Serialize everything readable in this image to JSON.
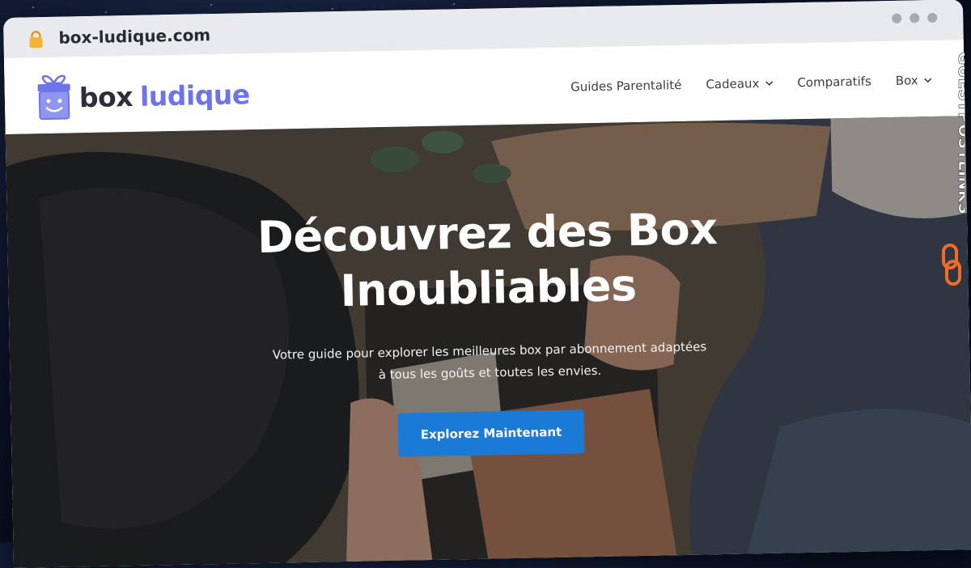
{
  "browser": {
    "url": "box-ludique.com"
  },
  "logo": {
    "word1": "box",
    "word2": "ludique"
  },
  "nav": {
    "items": [
      {
        "label": "Guides Parentalité",
        "has_dropdown": false
      },
      {
        "label": "Cadeaux",
        "has_dropdown": true
      },
      {
        "label": "Comparatifs",
        "has_dropdown": false
      },
      {
        "label": "Box",
        "has_dropdown": true
      }
    ]
  },
  "hero": {
    "title": "Découvrez des Box Inoubliables",
    "subtitle": "Votre guide pour explorer les meilleures box par abonnement adaptées à tous les goûts et toutes les envies.",
    "cta_label": "Explorez Maintenant"
  },
  "watermark": {
    "text": "GUESTPOSTLINKS"
  },
  "colors": {
    "brand_accent": "#6d73e8",
    "cta": "#1a7ad6",
    "watermark_orange": "#f26b2a"
  }
}
